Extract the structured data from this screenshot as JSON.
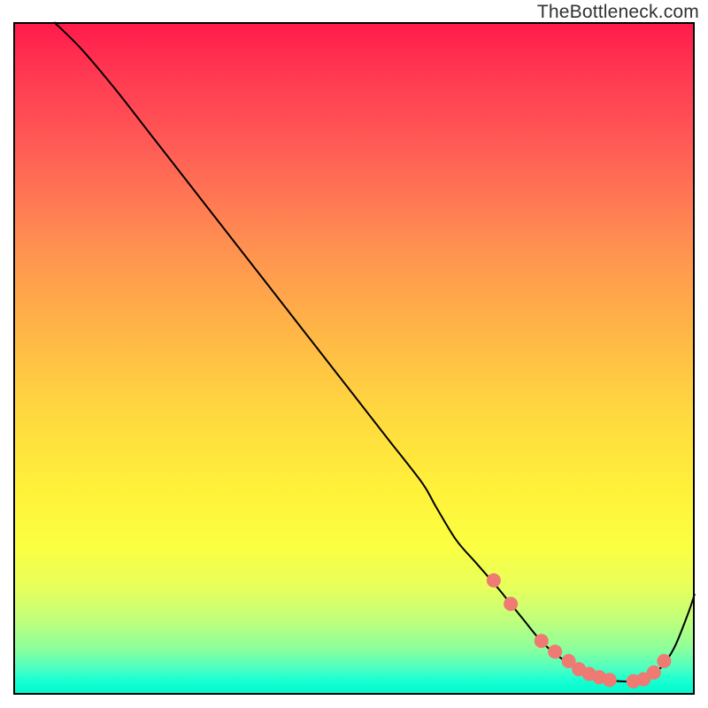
{
  "watermark": "TheBottleneck.com",
  "chart_data": {
    "type": "line",
    "title": "",
    "xlabel": "",
    "ylabel": "",
    "xlim": [
      0,
      100
    ],
    "ylim": [
      0,
      100
    ],
    "grid": false,
    "legend": false,
    "background_gradient": [
      {
        "stop": 0,
        "color": "#ff1a4b"
      },
      {
        "stop": 50,
        "color": "#ffd83f"
      },
      {
        "stop": 80,
        "color": "#fbff42"
      },
      {
        "stop": 100,
        "color": "#00f7c8"
      }
    ],
    "series": [
      {
        "name": "bottleneck-curve",
        "color": "#000000",
        "width": 2,
        "x": [
          6,
          10,
          15,
          20,
          25,
          30,
          35,
          40,
          45,
          50,
          55,
          60,
          62,
          65,
          68,
          71,
          73,
          75,
          77,
          79,
          81,
          83,
          85,
          87,
          89,
          91,
          93,
          95,
          97,
          99,
          100
        ],
        "y": [
          100,
          96,
          90,
          83.5,
          77,
          70.5,
          64,
          57.5,
          51,
          44.5,
          38,
          31.5,
          28,
          23,
          19.5,
          16,
          13.5,
          11,
          8.5,
          6.5,
          5,
          3.7,
          2.8,
          2.2,
          2,
          2,
          2.5,
          4,
          7,
          12,
          15
        ]
      }
    ],
    "markers": {
      "name": "highlighted-points",
      "color": "#ef7a74",
      "radius": 8,
      "x": [
        70.5,
        73,
        77.5,
        79.5,
        81.5,
        83,
        84.5,
        86,
        87.5,
        91,
        92.5,
        94,
        95.5
      ],
      "y": [
        17,
        13.5,
        8,
        6.4,
        5,
        3.8,
        3.1,
        2.6,
        2.2,
        2,
        2.3,
        3.3,
        5
      ]
    }
  }
}
